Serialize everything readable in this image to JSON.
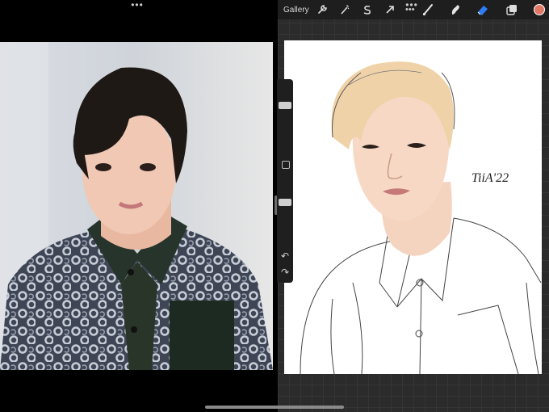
{
  "left_pane": {
    "photo_label": "Portrait photo of a young man with dark hair wearing a patterned shirt"
  },
  "toolbar": {
    "gallery_label": "Gallery",
    "icons": [
      "wrench-icon",
      "magic-wand-icon",
      "selection-s-icon",
      "transform-arrow-icon",
      "more-dots-icon",
      "brush-icon",
      "smudge-icon",
      "eraser-icon",
      "layers-icon",
      "color-swatch"
    ],
    "accent_color": "#2f7bf5",
    "current_color": "#e07868"
  },
  "canvas": {
    "signature": "TiiA'22"
  },
  "sidebar": {
    "brush_size_level": 0.72,
    "opacity_level": 0.55,
    "undo_icon": "undo-icon",
    "redo_icon": "redo-icon"
  }
}
